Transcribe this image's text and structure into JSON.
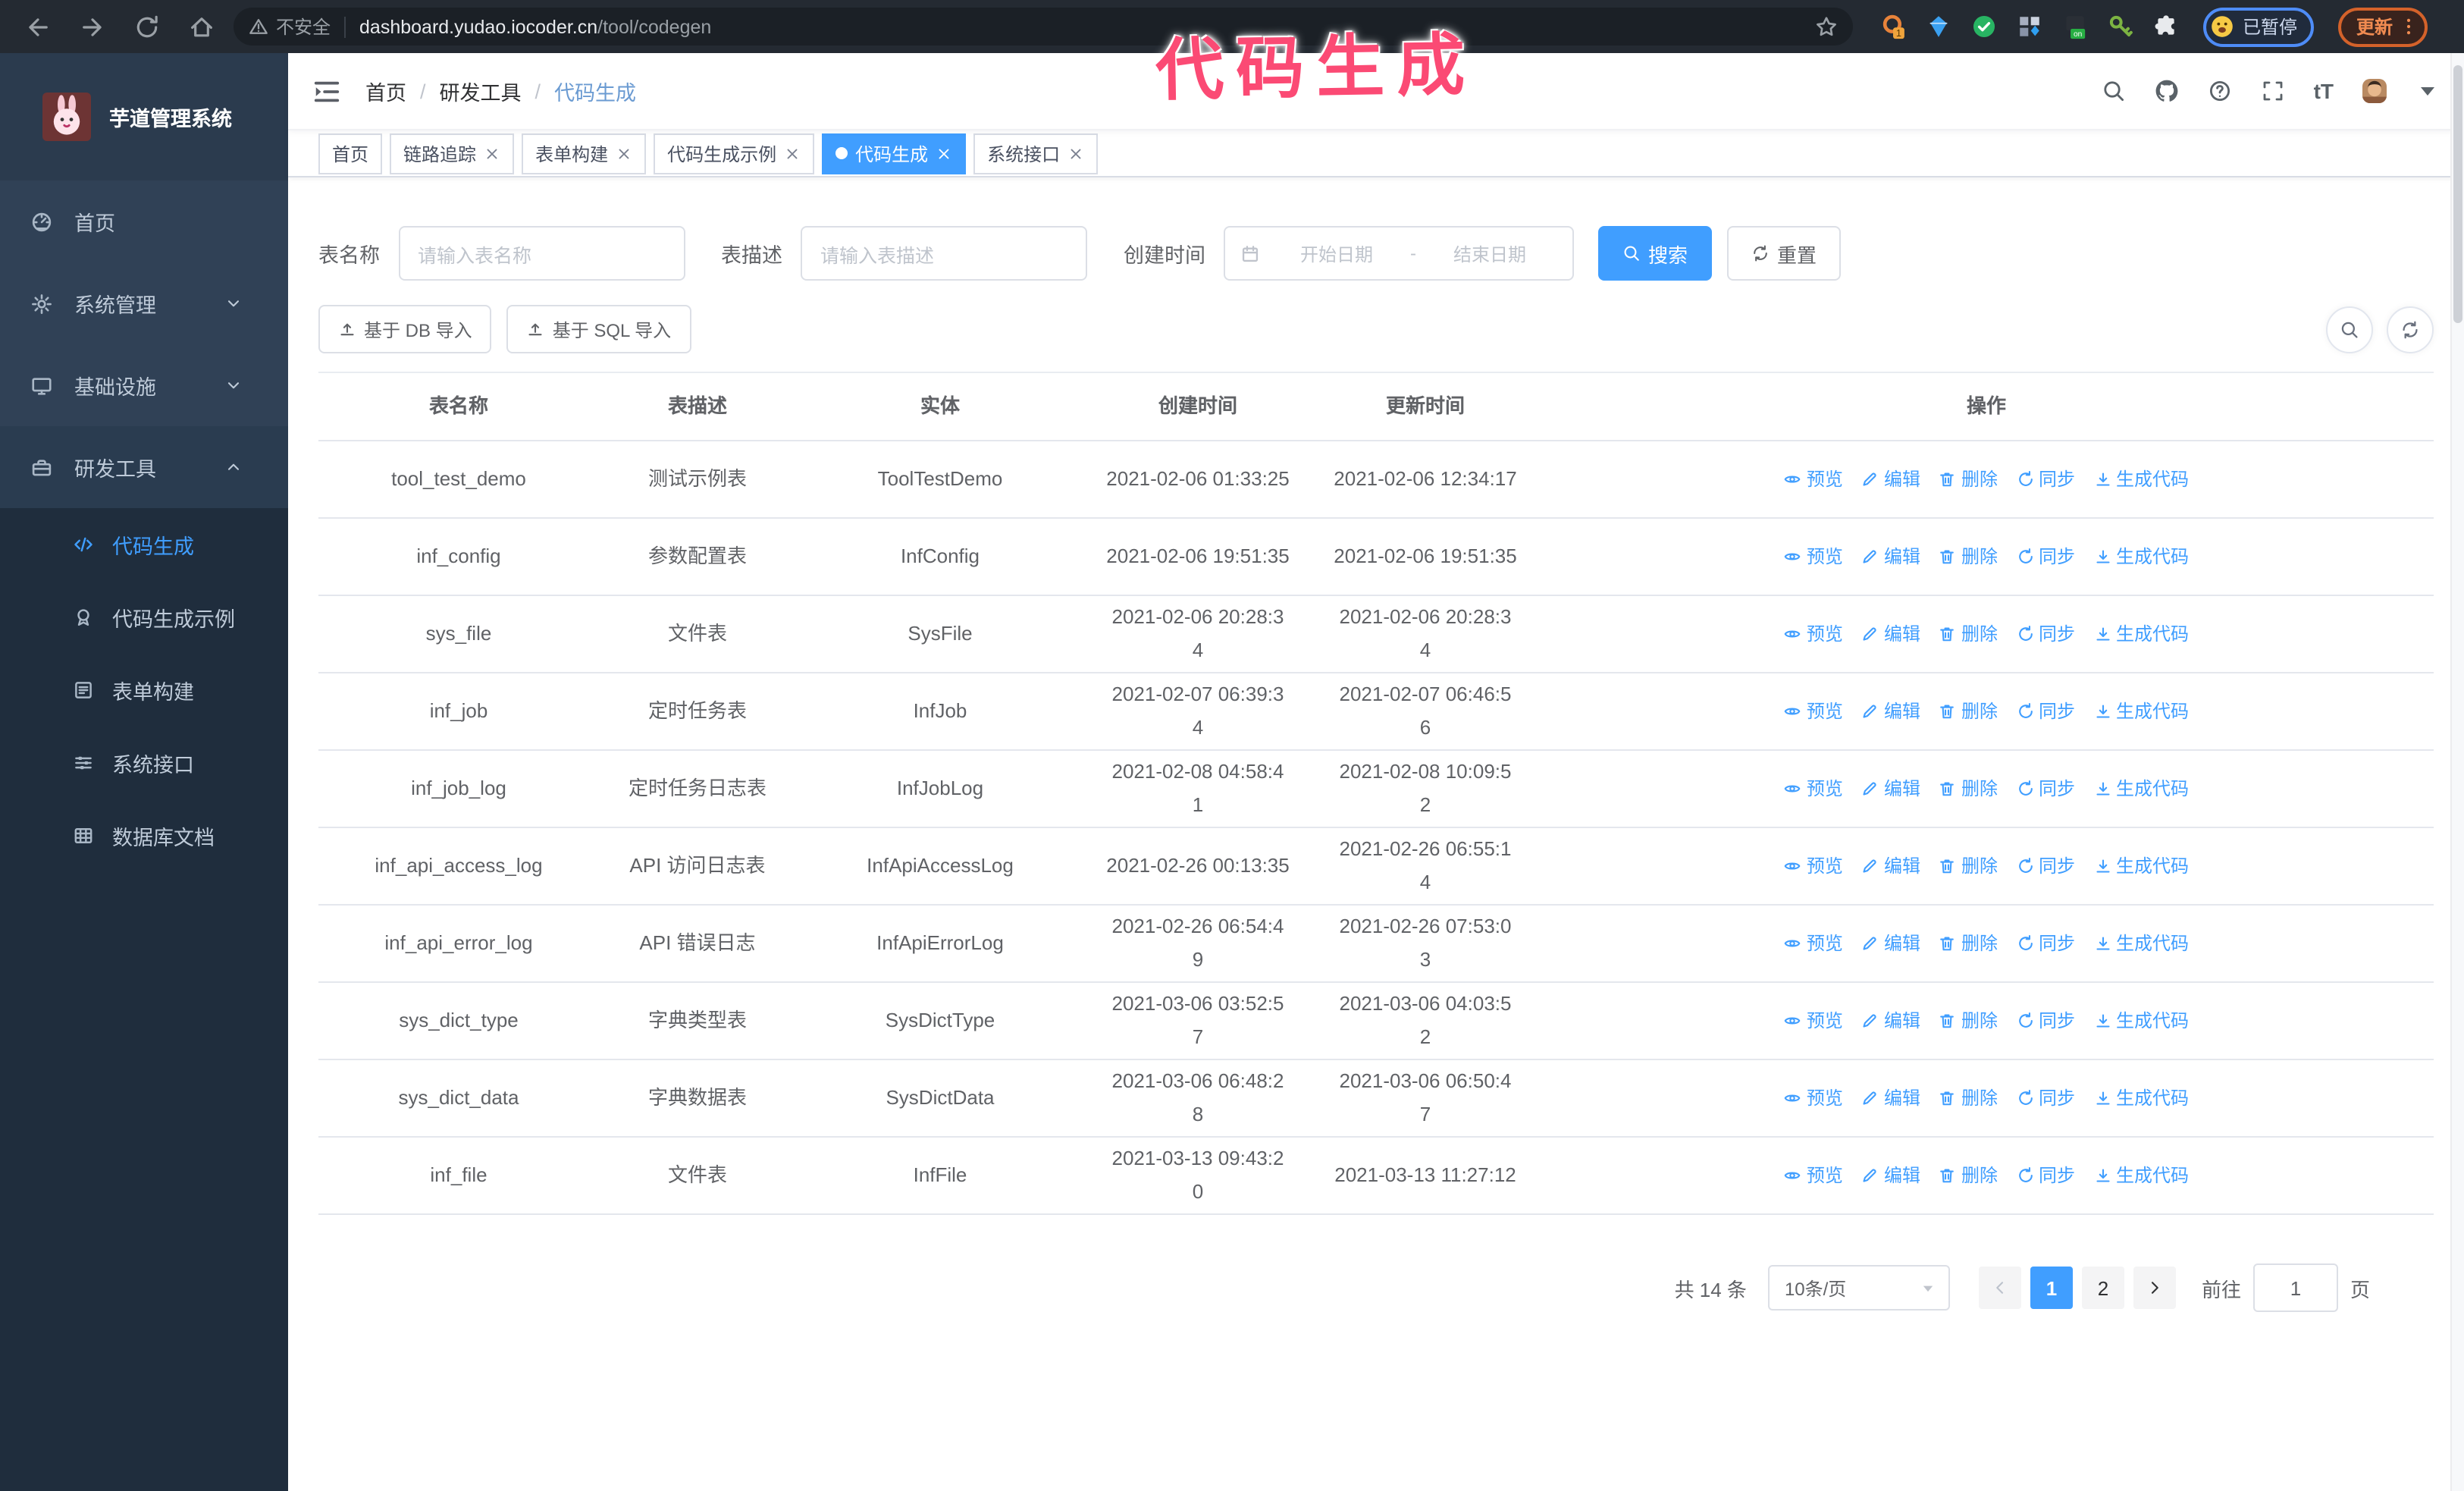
{
  "annotation": {
    "text": "代码生成",
    "color": "#fb4a74"
  },
  "browser": {
    "secure_label": "不安全",
    "url_host": "dashboard.yudao.iocoder.cn",
    "url_path": "/tool/codegen",
    "extensions": {
      "badge_1": "1",
      "badge_on": "on"
    },
    "paused_label": "已暂停",
    "update_label": "更新"
  },
  "sidebar": {
    "logo_title": "芋道管理系统",
    "items": [
      {
        "icon": "gauge-icon",
        "label": "首页",
        "chevron": ""
      },
      {
        "icon": "gear-icon",
        "label": "系统管理",
        "chevron": "down"
      },
      {
        "icon": "monitor-icon",
        "label": "基础设施",
        "chevron": "down"
      },
      {
        "icon": "toolbox-icon",
        "label": "研发工具",
        "chevron": "up",
        "expanded": true
      }
    ],
    "submenu": [
      {
        "icon": "code-icon",
        "label": "代码生成",
        "active": true
      },
      {
        "icon": "medal-icon",
        "label": "代码生成示例"
      },
      {
        "icon": "form-icon",
        "label": "表单构建"
      },
      {
        "icon": "sliders-icon",
        "label": "系统接口"
      },
      {
        "icon": "grid-icon",
        "label": "数据库文档"
      }
    ]
  },
  "nav": {
    "breadcrumb": [
      "首页",
      "研发工具",
      "代码生成"
    ],
    "separator": "/",
    "text_size_label": "tT"
  },
  "tabs": [
    {
      "label": "首页",
      "closable": false,
      "active": false
    },
    {
      "label": "链路追踪",
      "closable": true,
      "active": false
    },
    {
      "label": "表单构建",
      "closable": true,
      "active": false
    },
    {
      "label": "代码生成示例",
      "closable": true,
      "active": false
    },
    {
      "label": "代码生成",
      "closable": true,
      "active": true
    },
    {
      "label": "系统接口",
      "closable": true,
      "active": false
    }
  ],
  "filters": {
    "name_label": "表名称",
    "name_placeholder": "请输入表名称",
    "desc_label": "表描述",
    "desc_placeholder": "请输入表描述",
    "time_label": "创建时间",
    "start_placeholder": "开始日期",
    "range_separator": "-",
    "end_placeholder": "结束日期",
    "search_label": "搜索",
    "reset_label": "重置"
  },
  "toolbar": {
    "db_import_label": "基于 DB 导入",
    "sql_import_label": "基于 SQL 导入"
  },
  "table": {
    "headers": [
      "表名称",
      "表描述",
      "实体",
      "创建时间",
      "更新时间",
      "操作"
    ],
    "actions": [
      {
        "icon": "eye-icon",
        "label": "预览"
      },
      {
        "icon": "pencil-icon",
        "label": "编辑"
      },
      {
        "icon": "trash-icon",
        "label": "删除"
      },
      {
        "icon": "sync-icon",
        "label": "同步"
      },
      {
        "icon": "download-icon",
        "label": "生成代码"
      }
    ],
    "rows": [
      {
        "name": "tool_test_demo",
        "desc": "测试示例表",
        "entity": "ToolTestDemo",
        "created": "2021-02-06 01:33:25",
        "updated": "2021-02-06 12:34:17"
      },
      {
        "name": "inf_config",
        "desc": "参数配置表",
        "entity": "InfConfig",
        "created": "2021-02-06 19:51:35",
        "updated": "2021-02-06 19:51:35"
      },
      {
        "name": "sys_file",
        "desc": "文件表",
        "entity": "SysFile",
        "created": "2021-02-06 20:28:3\n4",
        "updated": "2021-02-06 20:28:3\n4"
      },
      {
        "name": "inf_job",
        "desc": "定时任务表",
        "entity": "InfJob",
        "created": "2021-02-07 06:39:3\n4",
        "updated": "2021-02-07 06:46:5\n6"
      },
      {
        "name": "inf_job_log",
        "desc": "定时任务日志表",
        "entity": "InfJobLog",
        "created": "2021-02-08 04:58:4\n1",
        "updated": "2021-02-08 10:09:5\n2"
      },
      {
        "name": "inf_api_access_log",
        "desc": "API 访问日志表",
        "entity": "InfApiAccessLog",
        "created": "2021-02-26 00:13:35",
        "updated": "2021-02-26 06:55:1\n4"
      },
      {
        "name": "inf_api_error_log",
        "desc": "API 错误日志",
        "entity": "InfApiErrorLog",
        "created": "2021-02-26 06:54:4\n9",
        "updated": "2021-02-26 07:53:0\n3"
      },
      {
        "name": "sys_dict_type",
        "desc": "字典类型表",
        "entity": "SysDictType",
        "created": "2021-03-06 03:52:5\n7",
        "updated": "2021-03-06 04:03:5\n2"
      },
      {
        "name": "sys_dict_data",
        "desc": "字典数据表",
        "entity": "SysDictData",
        "created": "2021-03-06 06:48:2\n8",
        "updated": "2021-03-06 06:50:4\n7"
      },
      {
        "name": "inf_file",
        "desc": "文件表",
        "entity": "InfFile",
        "created": "2021-03-13 09:43:2\n0",
        "updated": "2021-03-13 11:27:12"
      }
    ]
  },
  "pagination": {
    "total": "共 14 条",
    "page_size": "10条/页",
    "pages": [
      "1",
      "2"
    ],
    "active_page": "1",
    "goto_label": "前往",
    "goto_value": "1",
    "page_label": "页"
  },
  "colors": {
    "primary": "#409EFF",
    "sidebar_bg": "#304156",
    "submenu_bg": "#1f2d3d",
    "annotation_pink": "#fb4a74"
  }
}
